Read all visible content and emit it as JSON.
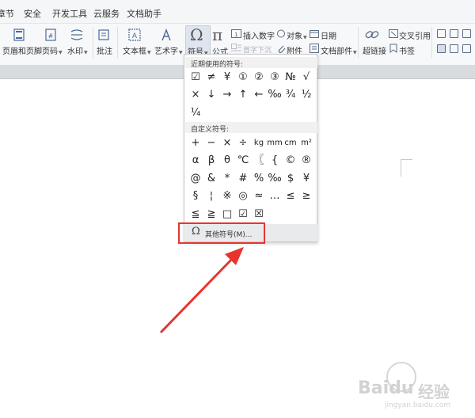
{
  "menubar": {
    "items": [
      "章节",
      "安全",
      "开发工具",
      "云服务",
      "文档助手"
    ]
  },
  "ribbon": {
    "header_footer": "页眉和页脚",
    "page_number": "页码",
    "watermark": "水印",
    "comment": "批注",
    "textbox": "文本框",
    "wordart": "艺术字",
    "symbol": "符号",
    "formula": "公式",
    "insert_number": "插入数字",
    "object": "对象",
    "date": "日期",
    "first_letter_sink": "首字下沉",
    "attachment": "附件",
    "document_parts": "文档部件",
    "hyperlink": "超链接",
    "cross_ref": "交叉引用",
    "bookmark": "书签"
  },
  "dropdown": {
    "recent_label": "近期使用的符号:",
    "recent_symbols": [
      "☑",
      "≠",
      "¥",
      "①",
      "②",
      "③",
      "№",
      "√",
      "×",
      "↓",
      "→",
      "↑",
      "←",
      "‰",
      "¾",
      "½",
      "¼"
    ],
    "custom_label": "自定义符号:",
    "custom_symbols": [
      "+",
      "−",
      "×",
      "÷",
      "kg",
      "mm",
      "cm",
      "m²",
      "α",
      "β",
      "θ",
      "℃",
      "〖",
      "{",
      "©",
      "®",
      "@",
      "&",
      "*",
      "#",
      "%",
      "‰",
      "$",
      "¥",
      "§",
      "¦",
      "※",
      "◎",
      "≈",
      "…",
      "≤",
      "≥",
      "≦",
      "≧",
      "□",
      "☑",
      "☒"
    ],
    "more_symbols": "其他符号(M)..."
  },
  "watermark": {
    "brand": "Baidu",
    "brand_cn": "经验",
    "url": "jingyan.baidu.com"
  },
  "colors": {
    "highlight_red": "#e8342f",
    "menu_bg": "#f5f6f7",
    "ribbon_bg": "#f7f8f9"
  }
}
